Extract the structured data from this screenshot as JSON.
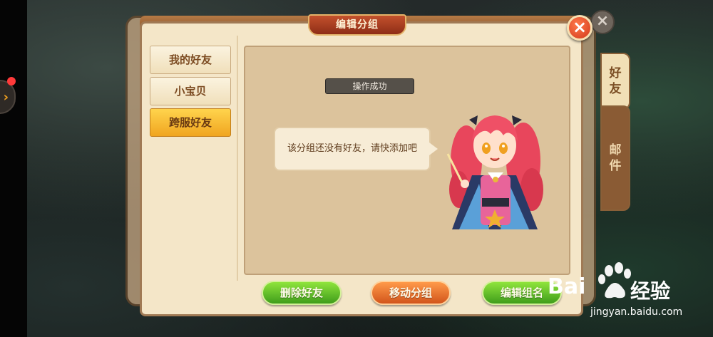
{
  "dialog": {
    "title": "编辑分组",
    "close_icon": "close-icon"
  },
  "groups": [
    {
      "label": "我的好友",
      "active": false
    },
    {
      "label": "小宝贝",
      "active": false
    },
    {
      "label": "跨服好友",
      "active": true
    }
  ],
  "toast": {
    "text": "操作成功"
  },
  "empty_message": "该分组还没有好友，请快添加吧",
  "buttons": {
    "delete_friend": "删除好友",
    "move_group": "移动分组",
    "rename_group": "编辑组名"
  },
  "side_tabs": {
    "friends": "好友",
    "mail": "邮件"
  },
  "watermark": {
    "brand": "Bai",
    "brand_cn": "经验",
    "url": "jingyan.baidu.com"
  },
  "colors": {
    "panel_bg": "#f4e6c8",
    "active_tab": "#f0a520",
    "green_button": "#3f9d1b",
    "orange_button": "#d2551b",
    "close_button": "#d2381c"
  }
}
